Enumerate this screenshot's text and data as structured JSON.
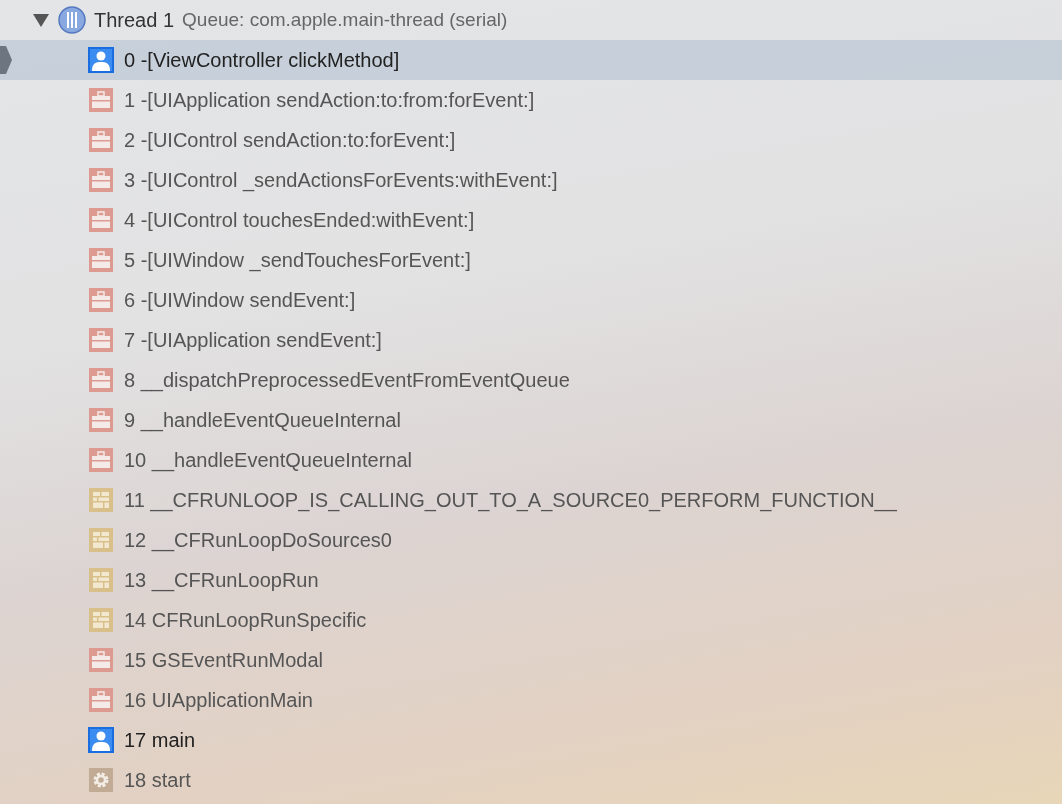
{
  "thread": {
    "expanded": true,
    "name": "Thread 1",
    "queue": "Queue: com.apple.main-thread (serial)"
  },
  "frames": [
    {
      "kind": "user",
      "label": "0 -[ViewController clickMethod]",
      "selected": true
    },
    {
      "kind": "framework",
      "label": "1 -[UIApplication sendAction:to:from:forEvent:]",
      "selected": false
    },
    {
      "kind": "framework",
      "label": "2 -[UIControl sendAction:to:forEvent:]",
      "selected": false
    },
    {
      "kind": "framework",
      "label": "3 -[UIControl _sendActionsForEvents:withEvent:]",
      "selected": false
    },
    {
      "kind": "framework",
      "label": "4 -[UIControl touchesEnded:withEvent:]",
      "selected": false
    },
    {
      "kind": "framework",
      "label": "5 -[UIWindow _sendTouchesForEvent:]",
      "selected": false
    },
    {
      "kind": "framework",
      "label": "6 -[UIWindow sendEvent:]",
      "selected": false
    },
    {
      "kind": "framework",
      "label": "7 -[UIApplication sendEvent:]",
      "selected": false
    },
    {
      "kind": "framework",
      "label": "8 __dispatchPreprocessedEventFromEventQueue",
      "selected": false
    },
    {
      "kind": "framework",
      "label": "9 __handleEventQueueInternal",
      "selected": false
    },
    {
      "kind": "framework",
      "label": "10 __handleEventQueueInternal",
      "selected": false
    },
    {
      "kind": "corefoundation",
      "label": "11 __CFRUNLOOP_IS_CALLING_OUT_TO_A_SOURCE0_PERFORM_FUNCTION__",
      "selected": false
    },
    {
      "kind": "corefoundation",
      "label": "12 __CFRunLoopDoSources0",
      "selected": false
    },
    {
      "kind": "corefoundation",
      "label": "13 __CFRunLoopRun",
      "selected": false
    },
    {
      "kind": "corefoundation",
      "label": "14 CFRunLoopRunSpecific",
      "selected": false
    },
    {
      "kind": "framework",
      "label": "15 GSEventRunModal",
      "selected": false
    },
    {
      "kind": "framework",
      "label": "16 UIApplicationMain",
      "selected": false
    },
    {
      "kind": "user",
      "label": "17 main",
      "selected": false
    },
    {
      "kind": "system",
      "label": "18 start",
      "selected": false
    }
  ]
}
